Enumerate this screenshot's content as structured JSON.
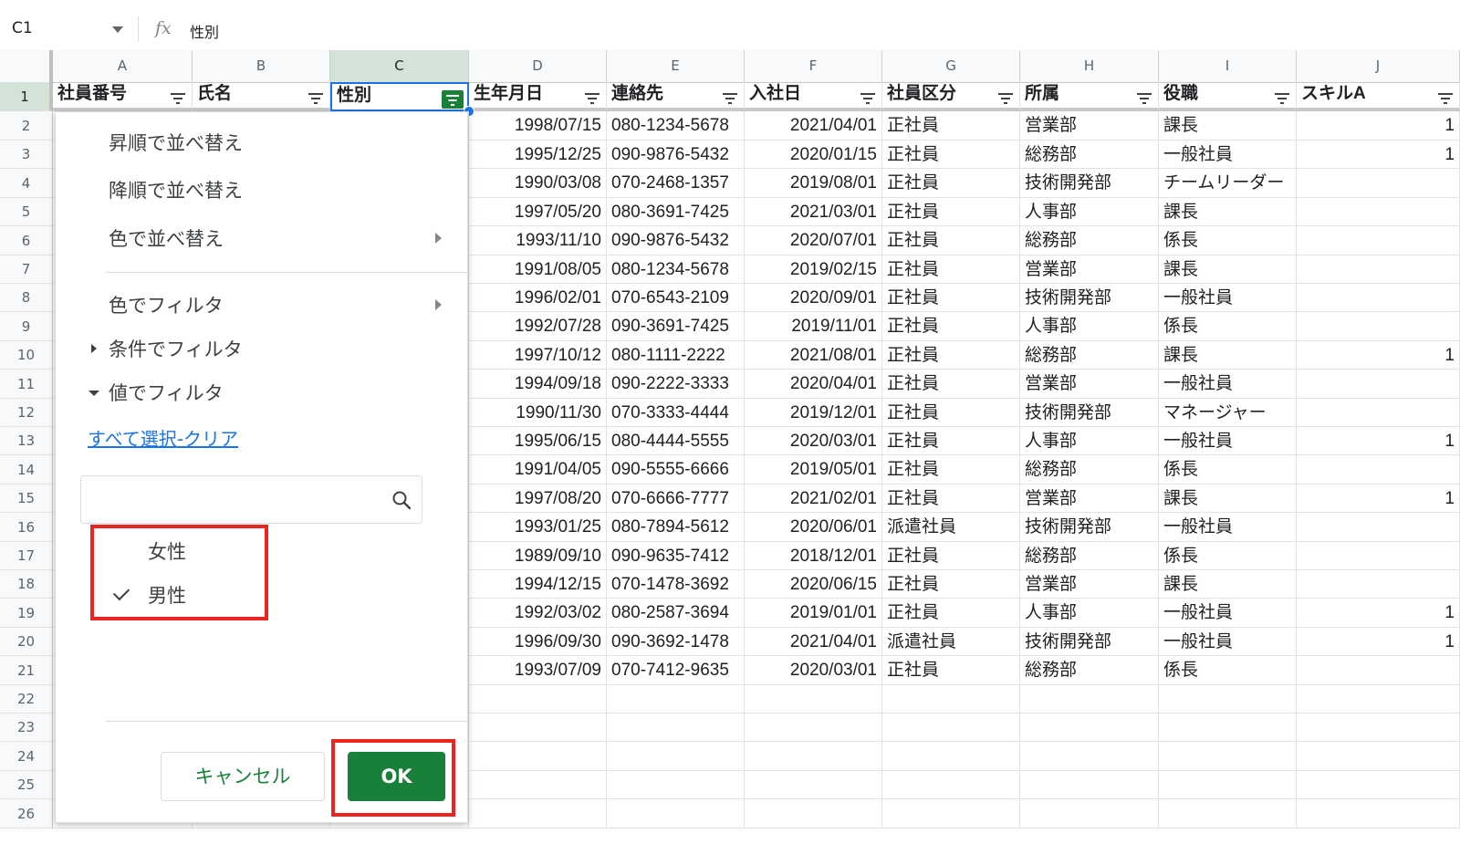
{
  "formula_bar": {
    "cell_ref": "C1",
    "fx_label": "fx",
    "content": "性別"
  },
  "columns": [
    "A",
    "B",
    "C",
    "D",
    "E",
    "F",
    "G",
    "H",
    "I",
    "J"
  ],
  "selected_column": "C",
  "row_numbers": [
    "1",
    "2",
    "3",
    "4",
    "5",
    "6",
    "7",
    "8",
    "9",
    "10",
    "11",
    "12",
    "13",
    "14",
    "15",
    "16",
    "17",
    "18",
    "19",
    "20",
    "21",
    "22",
    "23",
    "24",
    "25",
    "26"
  ],
  "headers": [
    "社員番号",
    "氏名",
    "性別",
    "生年月日",
    "連絡先",
    "入社日",
    "社員区分",
    "所属",
    "役職",
    "スキルA"
  ],
  "rows": [
    {
      "birth": "1998/07/15",
      "phone": "080-1234-5678",
      "join": "2021/04/01",
      "type": "正社員",
      "dept": "営業部",
      "title": "課長",
      "skill": "1"
    },
    {
      "birth": "1995/12/25",
      "phone": "090-9876-5432",
      "join": "2020/01/15",
      "type": "正社員",
      "dept": "総務部",
      "title": "一般社員",
      "skill": "1"
    },
    {
      "birth": "1990/03/08",
      "phone": "070-2468-1357",
      "join": "2019/08/01",
      "type": "正社員",
      "dept": "技術開発部",
      "title": "チームリーダー",
      "skill": ""
    },
    {
      "birth": "1997/05/20",
      "phone": "080-3691-7425",
      "join": "2021/03/01",
      "type": "正社員",
      "dept": "人事部",
      "title": "課長",
      "skill": ""
    },
    {
      "birth": "1993/11/10",
      "phone": "090-9876-5432",
      "join": "2020/07/01",
      "type": "正社員",
      "dept": "総務部",
      "title": "係長",
      "skill": ""
    },
    {
      "birth": "1991/08/05",
      "phone": "080-1234-5678",
      "join": "2019/02/15",
      "type": "正社員",
      "dept": "営業部",
      "title": "課長",
      "skill": ""
    },
    {
      "birth": "1996/02/01",
      "phone": "070-6543-2109",
      "join": "2020/09/01",
      "type": "正社員",
      "dept": "技術開発部",
      "title": "一般社員",
      "skill": ""
    },
    {
      "birth": "1992/07/28",
      "phone": "090-3691-7425",
      "join": "2019/11/01",
      "type": "正社員",
      "dept": "人事部",
      "title": "係長",
      "skill": ""
    },
    {
      "birth": "1997/10/12",
      "phone": "080-1111-2222",
      "join": "2021/08/01",
      "type": "正社員",
      "dept": "総務部",
      "title": "課長",
      "skill": "1"
    },
    {
      "birth": "1994/09/18",
      "phone": "090-2222-3333",
      "join": "2020/04/01",
      "type": "正社員",
      "dept": "営業部",
      "title": "一般社員",
      "skill": ""
    },
    {
      "birth": "1990/11/30",
      "phone": "070-3333-4444",
      "join": "2019/12/01",
      "type": "正社員",
      "dept": "技術開発部",
      "title": "マネージャー",
      "skill": ""
    },
    {
      "birth": "1995/06/15",
      "phone": "080-4444-5555",
      "join": "2020/03/01",
      "type": "正社員",
      "dept": "人事部",
      "title": "一般社員",
      "skill": "1"
    },
    {
      "birth": "1991/04/05",
      "phone": "090-5555-6666",
      "join": "2019/05/01",
      "type": "正社員",
      "dept": "総務部",
      "title": "係長",
      "skill": ""
    },
    {
      "birth": "1997/08/20",
      "phone": "070-6666-7777",
      "join": "2021/02/01",
      "type": "正社員",
      "dept": "営業部",
      "title": "課長",
      "skill": "1"
    },
    {
      "birth": "1993/01/25",
      "phone": "080-7894-5612",
      "join": "2020/06/01",
      "type": "派遣社員",
      "dept": "技術開発部",
      "title": "一般社員",
      "skill": ""
    },
    {
      "birth": "1989/09/10",
      "phone": "090-9635-7412",
      "join": "2018/12/01",
      "type": "正社員",
      "dept": "総務部",
      "title": "係長",
      "skill": ""
    },
    {
      "birth": "1994/12/15",
      "phone": "070-1478-3692",
      "join": "2020/06/15",
      "type": "正社員",
      "dept": "営業部",
      "title": "課長",
      "skill": ""
    },
    {
      "birth": "1992/03/02",
      "phone": "080-2587-3694",
      "join": "2019/01/01",
      "type": "正社員",
      "dept": "人事部",
      "title": "一般社員",
      "skill": "1"
    },
    {
      "birth": "1996/09/30",
      "phone": "090-3692-1478",
      "join": "2021/04/01",
      "type": "派遣社員",
      "dept": "技術開発部",
      "title": "一般社員",
      "skill": "1"
    },
    {
      "birth": "1993/07/09",
      "phone": "070-7412-9635",
      "join": "2020/03/01",
      "type": "正社員",
      "dept": "総務部",
      "title": "係長",
      "skill": ""
    }
  ],
  "filter_menu": {
    "sort_asc": "昇順で並べ替え",
    "sort_desc": "降順で並べ替え",
    "sort_color": "色で並べ替え",
    "filter_color": "色でフィルタ",
    "filter_condition": "条件でフィルタ",
    "filter_values": "値でフィルタ",
    "select_all": "すべて選択",
    "link_sep": "-",
    "clear": "クリア",
    "search_value": "",
    "values": [
      {
        "label": "女性",
        "checked": false
      },
      {
        "label": "男性",
        "checked": true
      }
    ],
    "cancel_label": "キャンセル",
    "ok_label": "OK"
  },
  "colors": {
    "accent_green": "#188038",
    "highlight_red": "#e8251f",
    "link_blue": "#1a73e8"
  }
}
